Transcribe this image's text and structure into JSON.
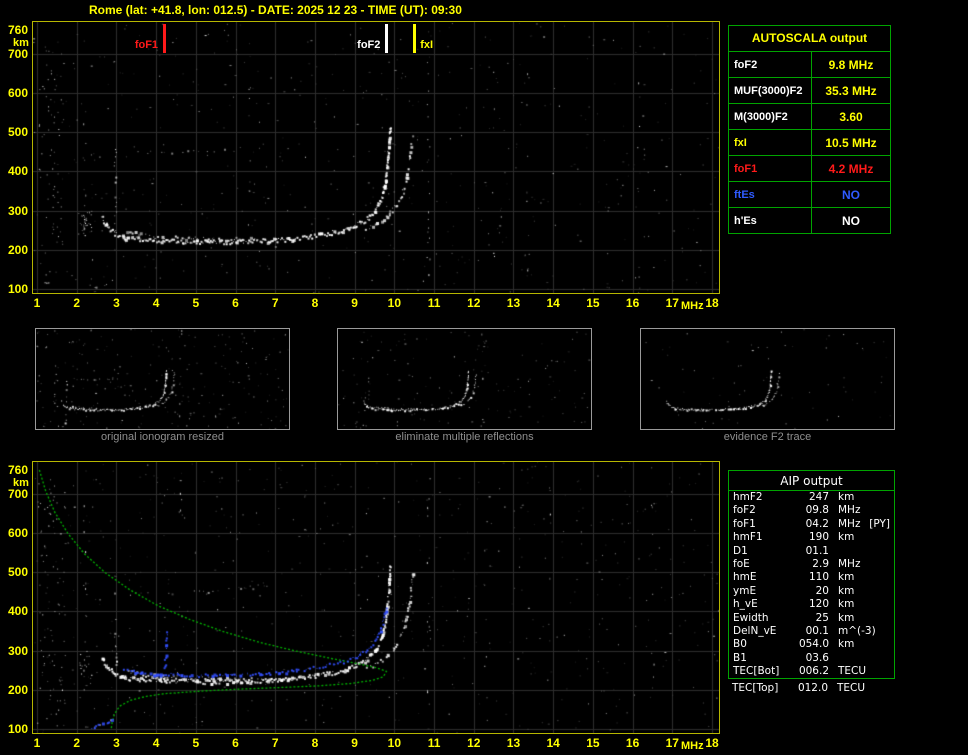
{
  "header": {
    "title": "Rome (lat: +41.8, lon: 012.5) - DATE: 2025 12 23 - TIME (UT): 09:30"
  },
  "colors": {
    "accent_yellow": "#ffff00",
    "grid": "#2e2e2e",
    "plot_border": "#b6b600",
    "table_border": "#00a400",
    "red": "#ff1a1a",
    "blue": "#2f5bff",
    "green_profile": "#00b400",
    "trace_white": "#ffffff",
    "caption_gray": "#8f8f8f"
  },
  "axes": {
    "x_ticks": [
      "1",
      "2",
      "3",
      "4",
      "5",
      "6",
      "7",
      "8",
      "9",
      "10",
      "11",
      "12",
      "13",
      "14",
      "15",
      "16",
      "17",
      "18"
    ],
    "x_unit": "MHz",
    "y_ticks": [
      760,
      700,
      600,
      500,
      400,
      300,
      200,
      100
    ],
    "y_unit": "km",
    "x_range": [
      1,
      18
    ],
    "y_range": [
      100,
      760
    ]
  },
  "autoscala": {
    "title": "AUTOSCALA output",
    "rows": [
      {
        "label": "foF2",
        "value": "9.8 MHz",
        "label_color": "#ffffff",
        "value_color": "#ffff00"
      },
      {
        "label": "MUF(3000)F2",
        "value": "35.3 MHz",
        "label_color": "#ffffff",
        "value_color": "#ffff00"
      },
      {
        "label": "M(3000)F2",
        "value": "3.60",
        "label_color": "#ffffff",
        "value_color": "#ffff00"
      },
      {
        "label": "fxI",
        "value": "10.5 MHz",
        "label_color": "#ffff00",
        "value_color": "#ffff00"
      },
      {
        "label": "foF1",
        "value": "4.2 MHz",
        "label_color": "#ff1a1a",
        "value_color": "#ff1a1a"
      },
      {
        "label": "ftEs",
        "value": "NO",
        "label_color": "#2f5bff",
        "value_color": "#2f5bff"
      },
      {
        "label": "h'Es",
        "value": "NO",
        "label_color": "#ffffff",
        "value_color": "#ffffff"
      }
    ]
  },
  "thumbnails": [
    {
      "caption": "original ionogram resized"
    },
    {
      "caption": "eliminate multiple reflections"
    },
    {
      "caption": "evidence F2 trace"
    }
  ],
  "aip": {
    "title": "AIP output",
    "rows": [
      {
        "label": "hmF2",
        "value": "247",
        "unit": "km",
        "extra": "",
        "inside": true
      },
      {
        "label": "foF2",
        "value": "09.8",
        "unit": "MHz",
        "extra": "",
        "inside": true
      },
      {
        "label": "foF1",
        "value": "04.2",
        "unit": "MHz",
        "extra": "[PY]",
        "inside": true
      },
      {
        "label": "hmF1",
        "value": "190",
        "unit": "km",
        "extra": "",
        "inside": true
      },
      {
        "label": "D1",
        "value": "01.1",
        "unit": "",
        "extra": "",
        "inside": true
      },
      {
        "label": "foE",
        "value": "2.9",
        "unit": "MHz",
        "extra": "",
        "inside": true
      },
      {
        "label": "hmE",
        "value": "110",
        "unit": "km",
        "extra": "",
        "inside": true
      },
      {
        "label": "ymE",
        "value": "20",
        "unit": "km",
        "extra": "",
        "inside": true
      },
      {
        "label": "h_vE",
        "value": "120",
        "unit": "km",
        "extra": "",
        "inside": true
      },
      {
        "label": "Ewidth",
        "value": "25",
        "unit": "km",
        "extra": "",
        "inside": true
      },
      {
        "label": "DelN_vE",
        "value": "00.1",
        "unit": "m^(-3)",
        "extra": "",
        "inside": true
      },
      {
        "label": "B0",
        "value": "054.0",
        "unit": "km",
        "extra": "",
        "inside": true
      },
      {
        "label": "B1",
        "value": "03.6",
        "unit": "",
        "extra": "",
        "inside": true
      },
      {
        "label": "TEC[Bot]",
        "value": "006.2",
        "unit": "TECU",
        "extra": "",
        "inside": true
      },
      {
        "label": "TEC[Top]",
        "value": "012.0",
        "unit": "TECU",
        "extra": "",
        "inside": false
      }
    ]
  },
  "chart_data": [
    {
      "type": "scatter",
      "title": "ionogram (virtual height vs frequency)",
      "xlabel": "MHz",
      "ylabel": "km",
      "xlim": [
        1,
        18
      ],
      "ylim": [
        100,
        760
      ],
      "grid": true,
      "markers": [
        {
          "label": "foF1",
          "x": 4.2,
          "color": "#ff1a1a",
          "label_side": "left"
        },
        {
          "label": "foF2",
          "x": 9.8,
          "color": "#ffffff",
          "label_side": "left"
        },
        {
          "label": "fxI",
          "x": 10.5,
          "color": "#ffff00",
          "label_side": "right"
        }
      ],
      "series": [
        {
          "name": "F-trace-ordinary",
          "color": "#ffffff",
          "render": "band",
          "points": [
            [
              2.62,
              285
            ],
            [
              2.75,
              260
            ],
            [
              2.95,
              243
            ],
            [
              3.2,
              233
            ],
            [
              3.6,
              228
            ],
            [
              4.2,
              225
            ],
            [
              5.0,
              222
            ],
            [
              6.0,
              222
            ],
            [
              6.8,
              225
            ],
            [
              7.4,
              229
            ],
            [
              8.0,
              237
            ],
            [
              8.6,
              249
            ],
            [
              9.0,
              263
            ],
            [
              9.3,
              281
            ],
            [
              9.5,
              302
            ],
            [
              9.65,
              330
            ],
            [
              9.74,
              365
            ],
            [
              9.8,
              410
            ],
            [
              9.85,
              465
            ],
            [
              9.88,
              515
            ]
          ]
        },
        {
          "name": "F-trace-extraordinary",
          "color": "#f0f0f0",
          "render": "band2",
          "points": [
            [
              9.25,
              252
            ],
            [
              9.55,
              268
            ],
            [
              9.85,
              292
            ],
            [
              10.05,
              318
            ],
            [
              10.2,
              350
            ],
            [
              10.3,
              390
            ],
            [
              10.38,
              440
            ],
            [
              10.44,
              500
            ]
          ]
        },
        {
          "name": "F-trace-low-doubling",
          "color": "#e0e0e0",
          "render": "band2",
          "points": [
            [
              3.25,
              250
            ],
            [
              3.6,
              241
            ],
            [
              4.1,
              236
            ],
            [
              4.8,
              231
            ],
            [
              5.6,
              229
            ],
            [
              6.4,
              229
            ]
          ]
        },
        {
          "name": "E-F-cusp",
          "color": "#ffffff",
          "render": "sparse",
          "points": [
            [
              2.98,
              245
            ],
            [
              2.96,
              455
            ]
          ]
        },
        {
          "name": "E-trace",
          "color": "#cccccc",
          "render": "faint",
          "points": [
            [
              2.15,
              104
            ],
            [
              2.45,
              108
            ],
            [
              2.7,
              115
            ],
            [
              2.88,
              126
            ],
            [
              2.95,
              140
            ]
          ]
        },
        {
          "name": "second-hop-echo",
          "color": "#b0b0b0",
          "render": "faint",
          "points": [
            [
              3.5,
              452
            ],
            [
              4.4,
              448
            ],
            [
              5.3,
              450
            ],
            [
              6.1,
              457
            ],
            [
              6.8,
              468
            ]
          ]
        }
      ]
    },
    {
      "type": "scatter",
      "title": "ionogram with AIP electron density profile and restored trace",
      "xlabel": "MHz",
      "ylabel": "km",
      "xlim": [
        1,
        18
      ],
      "ylim": [
        100,
        760
      ],
      "grid": true,
      "include_series_from": 0,
      "series": [
        {
          "name": "electron-density-profile",
          "color": "#00b400",
          "render": "line",
          "points": [
            [
              1.06,
              760
            ],
            [
              1.22,
              706
            ],
            [
              1.45,
              652
            ],
            [
              1.78,
              598
            ],
            [
              2.2,
              546
            ],
            [
              2.72,
              498
            ],
            [
              3.35,
              454
            ],
            [
              4.05,
              414
            ],
            [
              4.85,
              379
            ],
            [
              5.7,
              348
            ],
            [
              6.6,
              321
            ],
            [
              7.5,
              299
            ],
            [
              8.35,
              281
            ],
            [
              9.05,
              267
            ],
            [
              9.55,
              256
            ],
            [
              9.8,
              247
            ],
            [
              9.72,
              233
            ],
            [
              9.45,
              224
            ],
            [
              8.9,
              216
            ],
            [
              8.1,
              210
            ],
            [
              7.2,
              206
            ],
            [
              6.2,
              202
            ],
            [
              5.2,
              197
            ],
            [
              4.2,
              190
            ],
            [
              3.75,
              183
            ],
            [
              3.35,
              173
            ],
            [
              3.08,
              158
            ],
            [
              2.95,
              138
            ],
            [
              2.89,
              115
            ],
            [
              2.87,
              100
            ]
          ]
        },
        {
          "name": "restored-trace",
          "color": "#3350ff",
          "render": "dots",
          "points": [
            [
              3.15,
              252
            ],
            [
              3.6,
              245
            ],
            [
              4.1,
              241
            ],
            [
              4.7,
              239
            ],
            [
              5.4,
              238
            ],
            [
              6.1,
              239
            ],
            [
              6.8,
              243
            ],
            [
              7.5,
              250
            ],
            [
              8.1,
              259
            ],
            [
              8.7,
              272
            ],
            [
              9.1,
              288
            ],
            [
              9.4,
              310
            ],
            [
              9.58,
              338
            ],
            [
              9.7,
              375
            ],
            [
              9.77,
              418
            ]
          ]
        },
        {
          "name": "restored-F1-cusp",
          "color": "#3350ff",
          "render": "dots",
          "points": [
            [
              4.2,
              255
            ],
            [
              4.26,
              345
            ]
          ]
        },
        {
          "name": "restored-E-trace",
          "color": "#3350ff",
          "render": "dots",
          "points": [
            [
              2.35,
              104
            ],
            [
              2.55,
              110
            ],
            [
              2.75,
              118
            ],
            [
              2.9,
              128
            ]
          ]
        }
      ]
    }
  ]
}
